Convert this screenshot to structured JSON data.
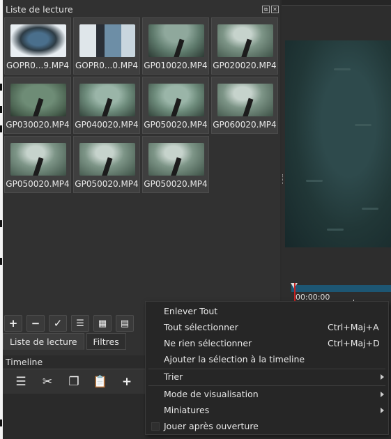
{
  "playlist": {
    "title": "Liste de lecture",
    "thumbnails": [
      {
        "name": "GOPR0...9.MP4",
        "kind": "selfie"
      },
      {
        "name": "GOPR0...0.MP4",
        "kind": "selfie2"
      },
      {
        "name": "GP010020.MP4",
        "kind": "sea"
      },
      {
        "name": "GP020020.MP4",
        "kind": "sea-wave"
      },
      {
        "name": "GP030020.MP4",
        "kind": "green"
      },
      {
        "name": "GP040020.MP4",
        "kind": "legs"
      },
      {
        "name": "GP050020.MP4",
        "kind": "legs"
      },
      {
        "name": "GP060020.MP4",
        "kind": "sea-wave"
      },
      {
        "name": "GP050020.MP4",
        "kind": "sea-wave"
      },
      {
        "name": "GP050020.MP4",
        "kind": "sea-wave"
      },
      {
        "name": "GP050020.MP4",
        "kind": "sea-wave"
      }
    ],
    "toolbar_icons": [
      "plus-icon",
      "minus-icon",
      "check-icon",
      "list-view-icon",
      "grid-view-icon",
      "details-view-icon"
    ],
    "tabs": {
      "playlist": "Liste de lecture",
      "filters": "Filtres"
    }
  },
  "timeline": {
    "title": "Timeline",
    "toolbar_icons": [
      "menu-icon",
      "scissors-icon",
      "copy-icon",
      "paste-icon",
      "plus-icon"
    ]
  },
  "viewer": {
    "timecode": "00:00:00"
  },
  "context_menu": {
    "items": {
      "remove_all": {
        "label": "Enlever Tout"
      },
      "select_all": {
        "label": "Tout sélectionner",
        "shortcut": "Ctrl+Maj+A"
      },
      "select_none": {
        "label": "Ne rien sélectionner",
        "shortcut": "Ctrl+Maj+D"
      },
      "add_to_timeline": {
        "label": "Ajouter la sélection à la timeline"
      },
      "sort": {
        "label": "Trier"
      },
      "view_mode": {
        "label": "Mode de visualisation"
      },
      "thumbnails": {
        "label": "Miniatures"
      },
      "play_after_open": {
        "label": "Jouer après ouverture",
        "checked": false
      }
    }
  },
  "colors": {
    "panel_bg": "#313131",
    "menu_bg": "#262626",
    "scrub_blue": "#1d5673",
    "playhead_red": "#c82020"
  }
}
